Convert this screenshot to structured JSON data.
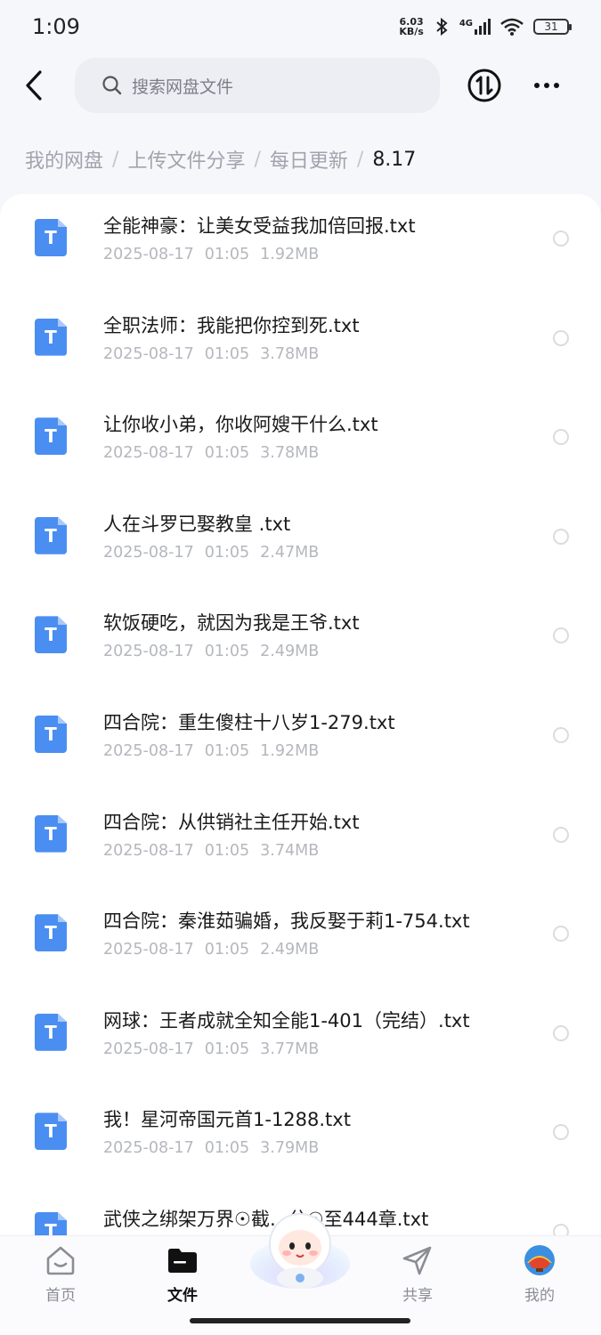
{
  "status_bar": {
    "time": "1:09",
    "net_speed_value": "6.03",
    "net_speed_unit": "KB/s",
    "signal_label": "4G",
    "battery": "31"
  },
  "search": {
    "placeholder": "搜索网盘文件"
  },
  "breadcrumb": [
    "我的网盘",
    "上传文件分享",
    "每日更新",
    "8.17"
  ],
  "files": [
    {
      "name": "全能神豪：让美女受益我加倍回报.txt",
      "date": "2025-08-17",
      "time": "01:05",
      "size": "1.92MB"
    },
    {
      "name": "全职法师：我能把你控到死.txt",
      "date": "2025-08-17",
      "time": "01:05",
      "size": "3.78MB"
    },
    {
      "name": "让你收小弟，你收阿嫂干什么.txt",
      "date": "2025-08-17",
      "time": "01:05",
      "size": "3.78MB"
    },
    {
      "name": "人在斗罗已娶教皇 .txt",
      "date": "2025-08-17",
      "time": "01:05",
      "size": "2.47MB"
    },
    {
      "name": "软饭硬吃，就因为我是王爷.txt",
      "date": "2025-08-17",
      "time": "01:05",
      "size": "2.49MB"
    },
    {
      "name": "四合院：重生傻柱十八岁1-279.txt",
      "date": "2025-08-17",
      "time": "01:05",
      "size": "1.92MB"
    },
    {
      "name": "四合院：从供销社主任开始.txt",
      "date": "2025-08-17",
      "time": "01:05",
      "size": "3.74MB"
    },
    {
      "name": "四合院：秦淮茹骗婚，我反娶于莉1-754.txt",
      "date": "2025-08-17",
      "time": "01:05",
      "size": "2.49MB"
    },
    {
      "name": "网球：王者成就全知全能1-401（完结）.txt",
      "date": "2025-08-17",
      "time": "01:05",
      "size": "3.77MB"
    },
    {
      "name": "我！星河帝国元首1-1288.txt",
      "date": "2025-08-17",
      "time": "01:05",
      "size": "3.79MB"
    },
    {
      "name": "武侠之绑架万界☉截…兮☉至444章.txt",
      "date": "",
      "time": "",
      "size": ""
    }
  ],
  "nav": [
    {
      "label": "首页",
      "icon": "home-icon",
      "active": false
    },
    {
      "label": "文件",
      "icon": "folder-icon",
      "active": true
    },
    {
      "label": "共享",
      "icon": "send-icon",
      "active": false
    },
    {
      "label": "我的",
      "icon": "avatar-icon",
      "active": false
    }
  ],
  "colors": {
    "accent": "#4a8ef1",
    "text": "#1a1a1a",
    "muted": "#b4b7bd"
  }
}
